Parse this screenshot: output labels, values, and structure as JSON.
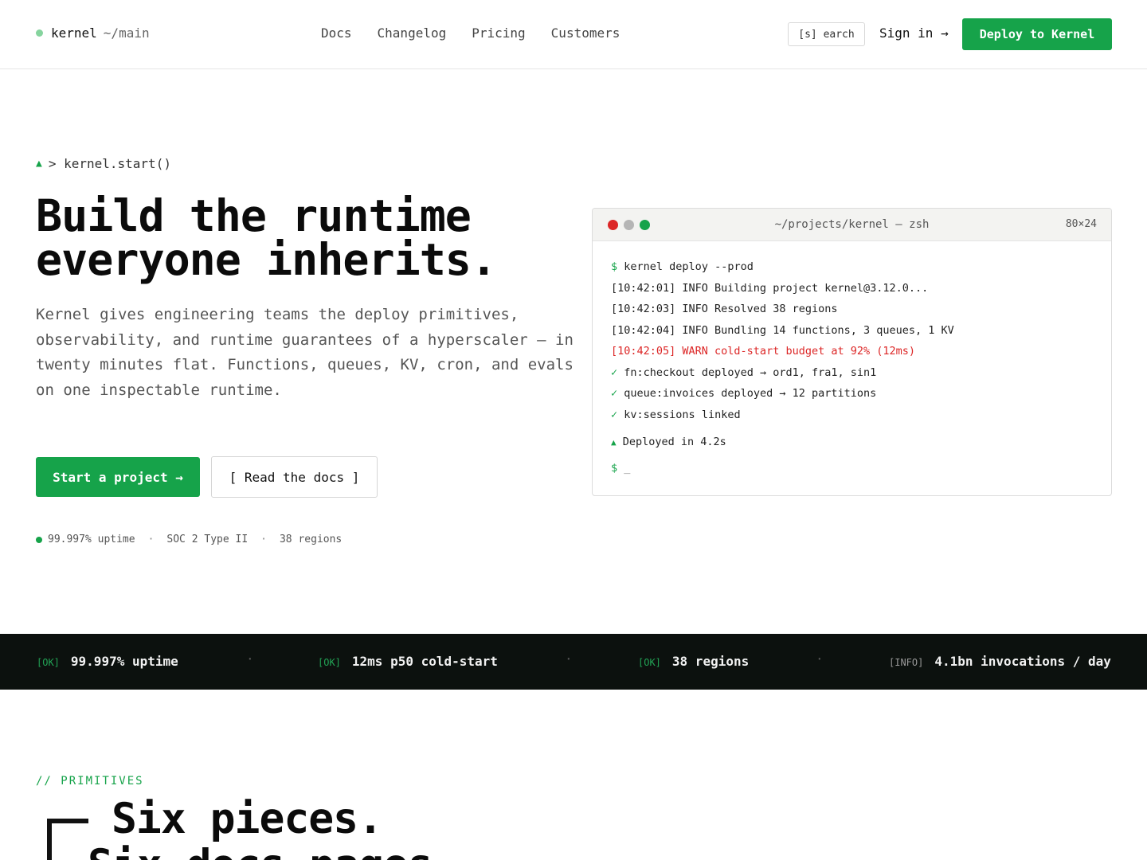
{
  "nav": {
    "brand": "kernel",
    "branch": "~/main",
    "links": [
      "Docs",
      "Changelog",
      "Pricing",
      "Customers"
    ],
    "search_label": "[s] earch",
    "signin": "Sign in →",
    "deploy": "Deploy to Kernel"
  },
  "hero": {
    "prompt": "> kernel.start()",
    "title_line1": "Build the runtime",
    "title_line2": "everyone inherits.",
    "description": "Kernel gives engineering teams the deploy primitives, observability, and runtime guarantees of a hyperscaler — in twenty minutes flat. Functions, queues, KV, cron, and evals on one inspectable runtime.",
    "cta_primary": "Start a project →",
    "cta_secondary": "[ Read the docs ]",
    "stats": [
      "99.997% uptime",
      "SOC 2 Type II",
      "38 regions"
    ]
  },
  "terminal": {
    "title": "~/projects/kernel — zsh",
    "size": "80×24",
    "command_prompt": "$",
    "command": "kernel deploy --prod",
    "logs": [
      "[10:42:01] INFO Building project kernel@3.12.0...",
      "[10:42:03] INFO Resolved 38 regions",
      "[10:42:04] INFO Bundling 14 functions, 3 queues, 1 KV"
    ],
    "warn": "[10:42:05] WARN cold-start budget at 92% (12ms)",
    "checks": [
      "fn:checkout deployed → ord1, fra1, sin1",
      "queue:invoices deployed → 12 partitions",
      "kv:sessions linked"
    ],
    "check_mark": "✓",
    "done": "Deployed in 4.2s",
    "done_mark": "▲",
    "cursor": "_"
  },
  "strip": {
    "items": [
      {
        "tag": "[OK]",
        "value": "99.997% uptime"
      },
      {
        "tag": "[OK]",
        "value": "12ms p50 cold-start"
      },
      {
        "tag": "[OK]",
        "value": "38 regions"
      },
      {
        "tag": "[INFO]",
        "value": "4.1bn invocations / day"
      }
    ],
    "separator": "·"
  },
  "primitives": {
    "label": "// PRIMITIVES",
    "title_line1": "Six pieces.",
    "title_line2": "Six docs pages."
  }
}
